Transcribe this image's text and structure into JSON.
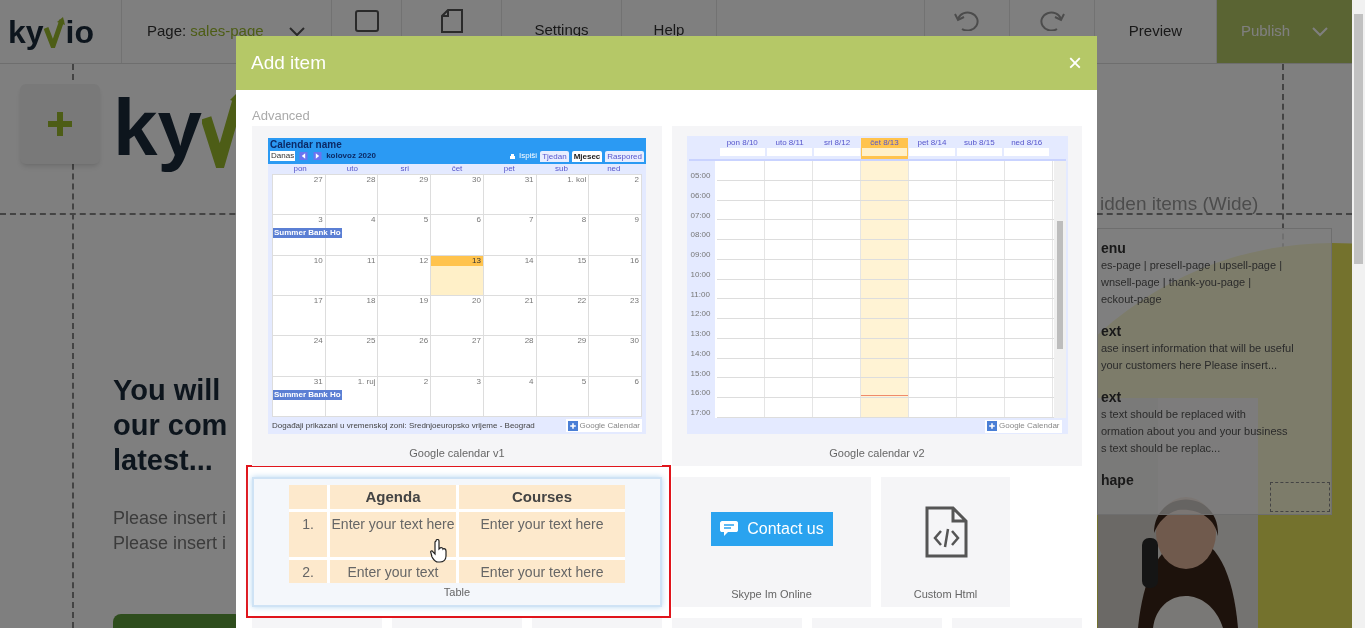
{
  "topbar": {
    "logo": {
      "left": "ky",
      "right": "io"
    },
    "page_label": "Page:",
    "page_value": "sales-page",
    "menu": [
      "Settings",
      "Help"
    ],
    "preview": "Preview",
    "publish": "Publish"
  },
  "canvas": {
    "logo_left": "ky",
    "heading": [
      "You will",
      "our com",
      "latest..."
    ],
    "paragraphs": [
      "Please insert i",
      "Please insert i"
    ],
    "hidden_panel": {
      "title": "idden items (Wide)",
      "items": [
        {
          "title": "enu",
          "lines": [
            "es-page | presell-page | upsell-page |",
            "wnsell-page | thank-you-page |",
            "eckout-page"
          ]
        },
        {
          "title": "ext",
          "lines": [
            "ase insert information that will be useful",
            "your customers here Please insert..."
          ]
        },
        {
          "title": "ext",
          "lines": [
            "s text should be replaced with",
            "ormation about you and your business",
            "s text should be replac..."
          ]
        },
        {
          "title": "hape"
        }
      ]
    }
  },
  "modal": {
    "title": "Add item",
    "close": "×",
    "section": "Advanced",
    "items": [
      {
        "kind": "calendar_month",
        "caption": "Google calendar v1",
        "selected": false,
        "annotated": false,
        "title": "Calendar name",
        "today_button": "Danas",
        "month": "kolovoz 2020",
        "print": "Ispiši",
        "views": [
          {
            "label": "Tjedan",
            "selected": false
          },
          {
            "label": "Mjesec",
            "selected": true
          },
          {
            "label": "Raspored",
            "selected": false
          }
        ],
        "weekdays": [
          "pon",
          "uto",
          "sri",
          "čet",
          "pet",
          "sub",
          "ned"
        ],
        "weeks": [
          [
            {
              "day": "27",
              "today": false
            },
            {
              "day": "28",
              "today": false
            },
            {
              "day": "29",
              "today": false
            },
            {
              "day": "30",
              "today": false
            },
            {
              "day": "31",
              "today": false
            },
            {
              "day": "1. kol",
              "today": false
            },
            {
              "day": "2",
              "today": false
            }
          ],
          [
            {
              "day": "3",
              "today": false,
              "event": "Summer Bank Ho"
            },
            {
              "day": "4",
              "today": false
            },
            {
              "day": "5",
              "today": false
            },
            {
              "day": "6",
              "today": false
            },
            {
              "day": "7",
              "today": false
            },
            {
              "day": "8",
              "today": false
            },
            {
              "day": "9",
              "today": false
            }
          ],
          [
            {
              "day": "10",
              "today": false
            },
            {
              "day": "11",
              "today": false
            },
            {
              "day": "12",
              "today": false
            },
            {
              "day": "13",
              "today": true
            },
            {
              "day": "14",
              "today": false
            },
            {
              "day": "15",
              "today": false
            },
            {
              "day": "16",
              "today": false
            }
          ],
          [
            {
              "day": "17",
              "today": false
            },
            {
              "day": "18",
              "today": false
            },
            {
              "day": "19",
              "today": false
            },
            {
              "day": "20",
              "today": false
            },
            {
              "day": "21",
              "today": false
            },
            {
              "day": "22",
              "today": false
            },
            {
              "day": "23",
              "today": false
            }
          ],
          [
            {
              "day": "24",
              "today": false
            },
            {
              "day": "25",
              "today": false
            },
            {
              "day": "26",
              "today": false
            },
            {
              "day": "27",
              "today": false
            },
            {
              "day": "28",
              "today": false
            },
            {
              "day": "29",
              "today": false
            },
            {
              "day": "30",
              "today": false
            }
          ],
          [
            {
              "day": "31",
              "today": false,
              "event": "Summer Bank Ho"
            },
            {
              "day": "1. ruj",
              "today": false
            },
            {
              "day": "2",
              "today": false
            },
            {
              "day": "3",
              "today": false
            },
            {
              "day": "4",
              "today": false
            },
            {
              "day": "5",
              "today": false
            },
            {
              "day": "6",
              "today": false
            }
          ]
        ],
        "footer": "Događaji prikazani u vremenskoj zoni: Srednjoeuropsko vrijeme - Beograd",
        "badge": "Google Calendar"
      },
      {
        "kind": "calendar_week",
        "caption": "Google calendar v2",
        "selected": false,
        "annotated": false,
        "days": [
          {
            "label": "pon 8/10",
            "today": false
          },
          {
            "label": "uto 8/11",
            "today": false
          },
          {
            "label": "sri 8/12",
            "today": false
          },
          {
            "label": "čet 8/13",
            "today": true
          },
          {
            "label": "pet 8/14",
            "today": false
          },
          {
            "label": "sub 8/15",
            "today": false
          },
          {
            "label": "ned 8/16",
            "today": false
          }
        ],
        "times": [
          "05:00",
          "06:00",
          "07:00",
          "08:00",
          "09:00",
          "10:00",
          "11:00",
          "12:00",
          "13:00",
          "14:00",
          "15:00",
          "16:00",
          "17:00"
        ],
        "badge": "Google Calendar"
      },
      {
        "kind": "table",
        "caption": "Table",
        "selected": true,
        "annotated": true,
        "header": [
          "Agenda",
          "Courses"
        ],
        "rows": [
          [
            "1.",
            "Enter your text here",
            "Enter your text here"
          ],
          [
            "2.",
            "Enter your text",
            "Enter your text here"
          ]
        ]
      },
      {
        "kind": "button_widget",
        "caption": "Skype Im Online",
        "selected": false,
        "annotated": false,
        "button": "Contact us"
      },
      {
        "kind": "icon_widget",
        "caption": "Custom Html",
        "selected": false,
        "annotated": false
      },
      {
        "kind": "blank",
        "selected": false,
        "annotated": false
      },
      {
        "kind": "blank",
        "selected": false,
        "annotated": false
      },
      {
        "kind": "blank",
        "selected": false,
        "annotated": false
      },
      {
        "kind": "blank",
        "selected": false,
        "annotated": false
      },
      {
        "kind": "blank",
        "selected": false,
        "annotated": false
      },
      {
        "kind": "blank",
        "selected": false,
        "annotated": false
      }
    ]
  }
}
